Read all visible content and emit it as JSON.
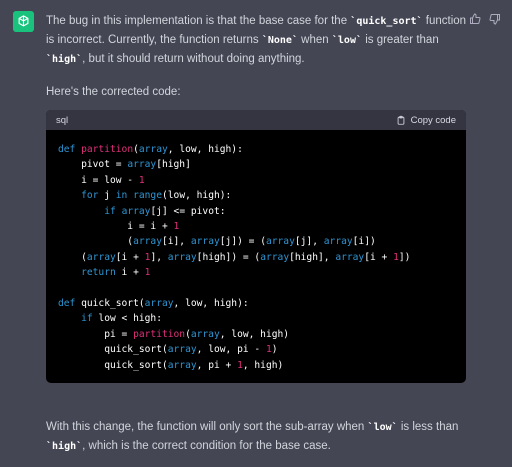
{
  "message": {
    "intro_parts": [
      "The bug in this implementation is that the base case for the ",
      "quick_sort",
      " function is incorrect. Currently, the function returns ",
      "None",
      " when ",
      "low",
      " is greater than ",
      "high",
      ", but it should return without doing anything."
    ],
    "lead": "Here's the corrected code:",
    "outro_parts": [
      "With this change, the function will only sort the sub-array when ",
      "low",
      " is less than ",
      "high",
      ", which is the correct condition for the base case."
    ]
  },
  "code_block": {
    "language": "sql",
    "copy_label": "Copy code"
  },
  "icons": [
    "chatgpt-logo-icon",
    "thumbs-up-icon",
    "thumbs-down-icon",
    "clipboard-icon"
  ],
  "colors": {
    "background": "#444654",
    "avatar": "#19c37d",
    "keyword": "#2e95d3",
    "function": "#df3079"
  }
}
